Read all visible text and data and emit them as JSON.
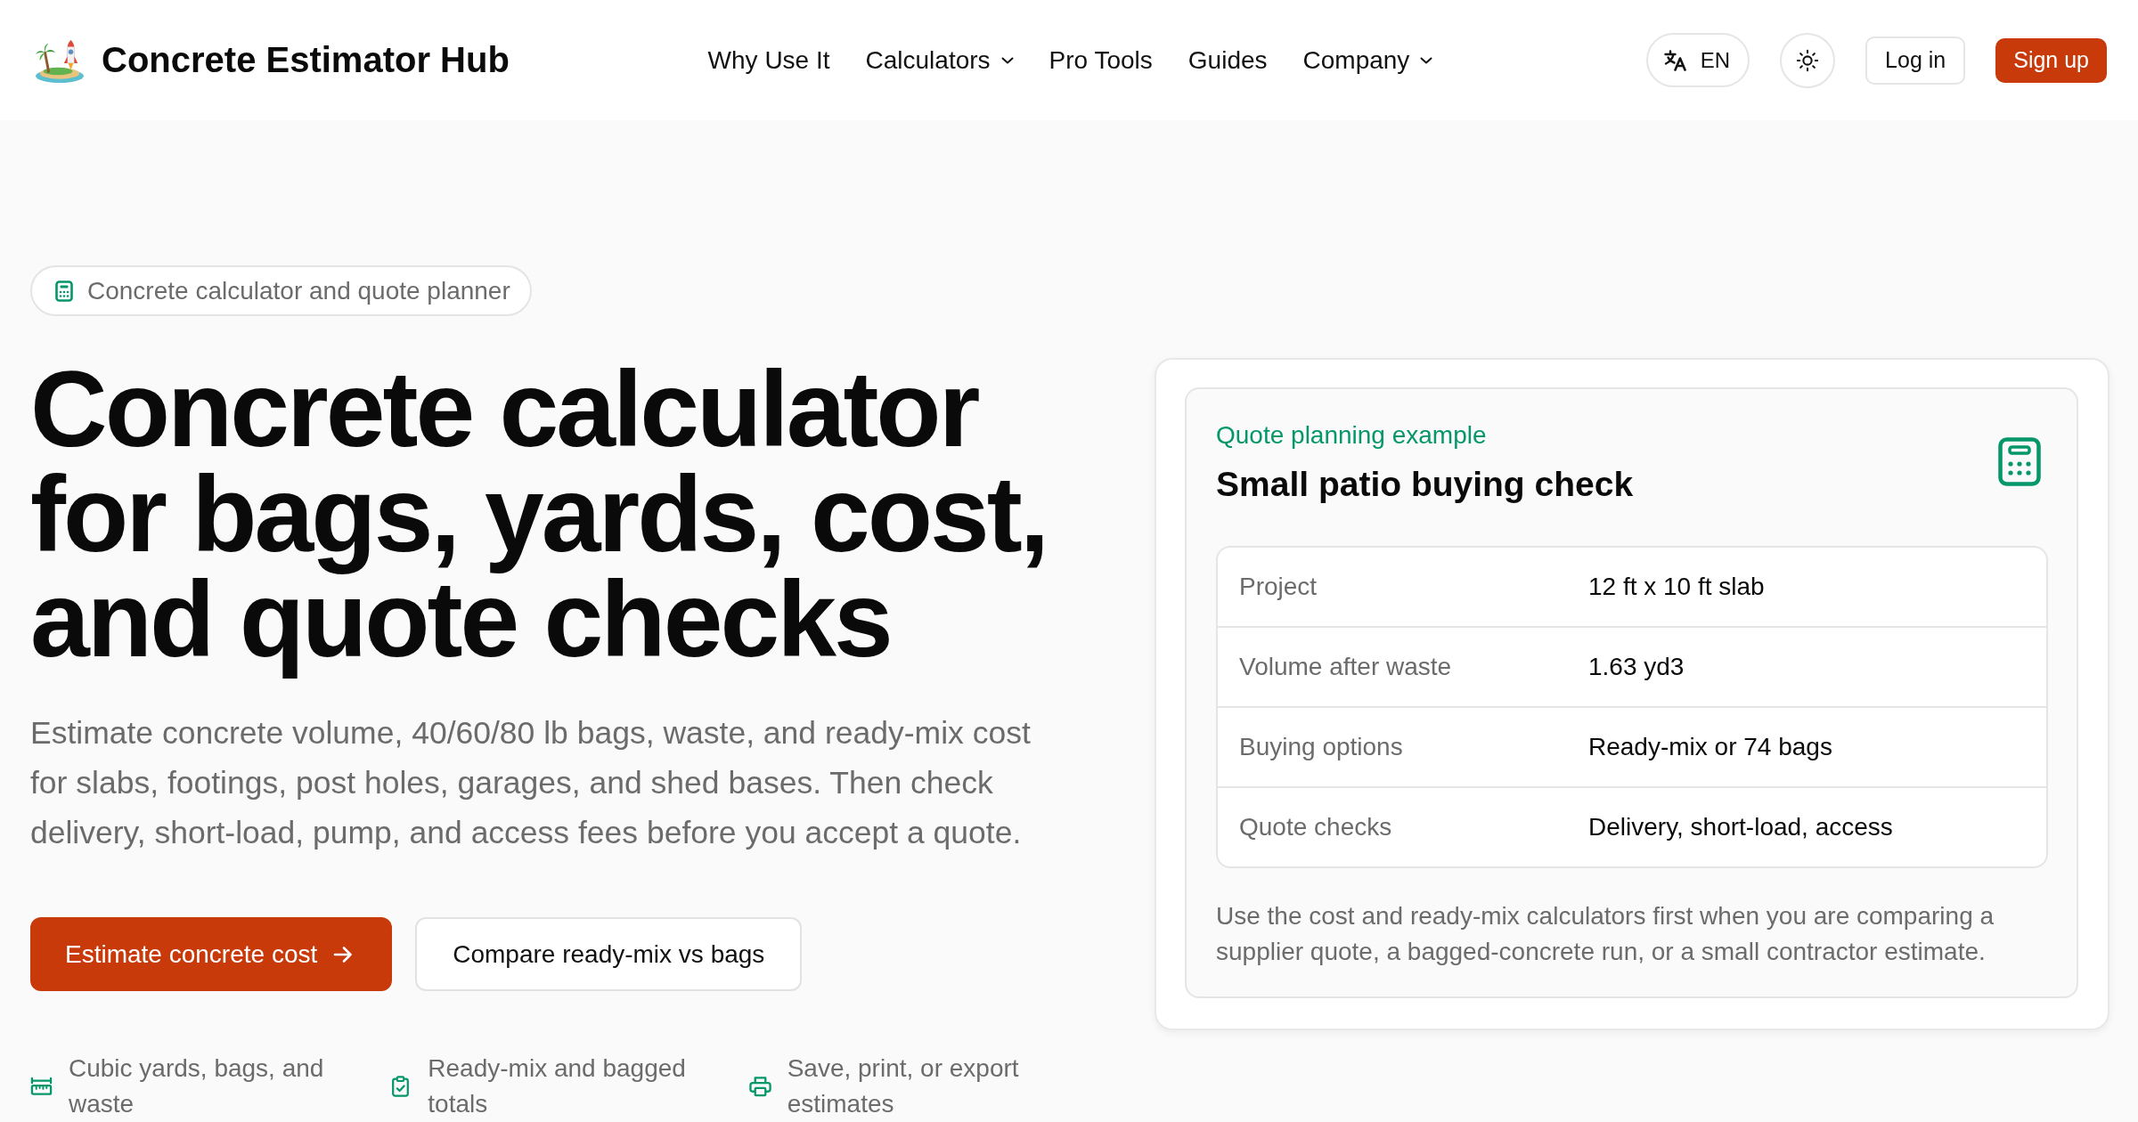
{
  "header": {
    "brand": "Concrete Estimator Hub",
    "nav": [
      {
        "label": "Why Use It",
        "dropdown": false
      },
      {
        "label": "Calculators",
        "dropdown": true
      },
      {
        "label": "Pro Tools",
        "dropdown": false
      },
      {
        "label": "Guides",
        "dropdown": false
      },
      {
        "label": "Company",
        "dropdown": true
      }
    ],
    "language": "EN",
    "login": "Log in",
    "signup": "Sign up"
  },
  "hero": {
    "badge": "Concrete calculator and quote planner",
    "title": "Concrete calculator for bags, yards, cost, and quote checks",
    "description": "Estimate concrete volume, 40/60/80 lb bags, waste, and ready-mix cost for slabs, footings, post holes, garages, and shed bases. Then check delivery, short-load, pump, and access fees before you accept a quote.",
    "buttons": [
      {
        "label": "Estimate concrete cost",
        "kind": "primary"
      },
      {
        "label": "Compare ready-mix vs bags",
        "kind": "secondary"
      }
    ],
    "features": [
      "Cubic yards, bags, and waste",
      "Ready-mix and bagged totals",
      "Save, print, or export estimates"
    ]
  },
  "example": {
    "eyebrow": "Quote planning example",
    "title": "Small patio buying check",
    "rows": [
      {
        "label": "Project",
        "value": "12 ft x 10 ft slab"
      },
      {
        "label": "Volume after waste",
        "value": "1.63 yd3"
      },
      {
        "label": "Buying options",
        "value": "Ready-mix or 74 bags"
      },
      {
        "label": "Quote checks",
        "value": "Delivery, short-load, access"
      }
    ],
    "note": "Use the cost and ready-mix calculators first when you are comparing a supplier quote, a bagged-concrete run, or a small contractor estimate."
  }
}
